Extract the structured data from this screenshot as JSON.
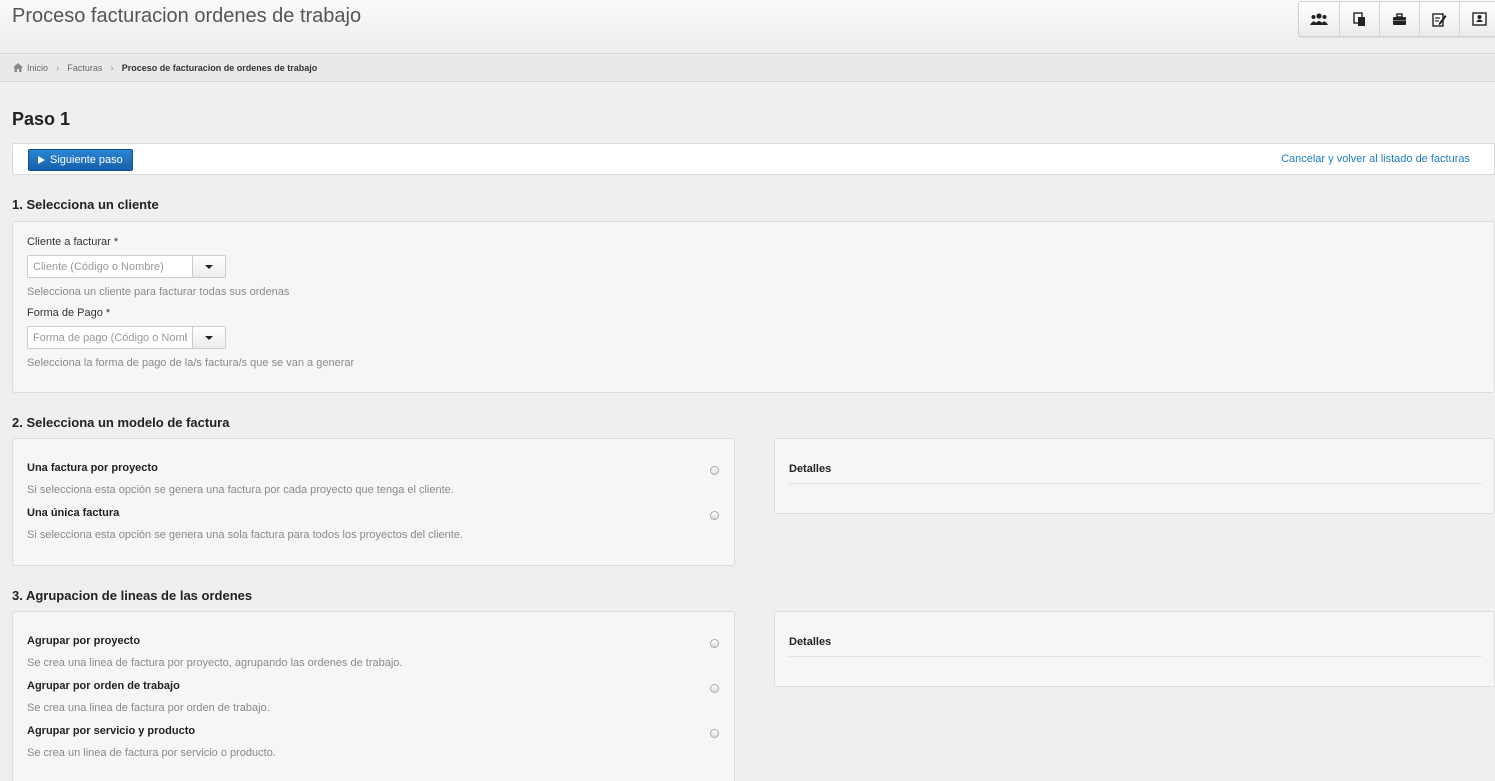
{
  "header": {
    "title": "Proceso facturacion ordenes de trabajo",
    "toolbar": [
      {
        "icon": "users-icon"
      },
      {
        "icon": "documents-icon"
      },
      {
        "icon": "briefcase-icon"
      },
      {
        "icon": "edit-note-icon"
      },
      {
        "icon": "contact-card-icon"
      }
    ]
  },
  "breadcrumb": {
    "home": "Inicio",
    "parent": "Facturas",
    "current": "Proceso de facturacion de ordenes de trabajo"
  },
  "step_title": "Paso 1",
  "actionbar": {
    "next_label": "Siguiente paso",
    "cancel_label": "Cancelar y volver al listado de facturas"
  },
  "section1": {
    "title": "1. Selecciona un cliente",
    "client_label": "Cliente a facturar *",
    "client_placeholder": "Cliente (Código o Nombre)",
    "client_help": "Selecciona un cliente para facturar todas sus ordenas",
    "payment_label": "Forma de Pago *",
    "payment_placeholder": "Forma de pago (Código o Nombre)",
    "payment_help": "Selecciona la forma de pago de la/s factura/s que se van a generar"
  },
  "section2": {
    "title": "2. Selecciona un modelo de factura",
    "options": [
      {
        "label": "Una factura por proyecto",
        "desc": "Si selecciona esta opción se genera una factura por cada proyecto que tenga el cliente."
      },
      {
        "label": "Una única factura",
        "desc": "Si selecciona esta opción se genera una sola factura para todos los proyectos del cliente."
      }
    ],
    "details_title": "Detalles"
  },
  "section3": {
    "title": "3. Agrupacion de lineas de las ordenes",
    "options": [
      {
        "label": "Agrupar por proyecto",
        "desc": "Se crea una linea de factura por proyecto, agrupando las ordenes de trabajo."
      },
      {
        "label": "Agrupar por orden de trabajo",
        "desc": "Se crea una linea de factura por orden de trabajo."
      },
      {
        "label": "Agrupar por servicio y producto",
        "desc": "Se crea un linea de factura por servicio o producto."
      }
    ],
    "details_title": "Detalles"
  }
}
